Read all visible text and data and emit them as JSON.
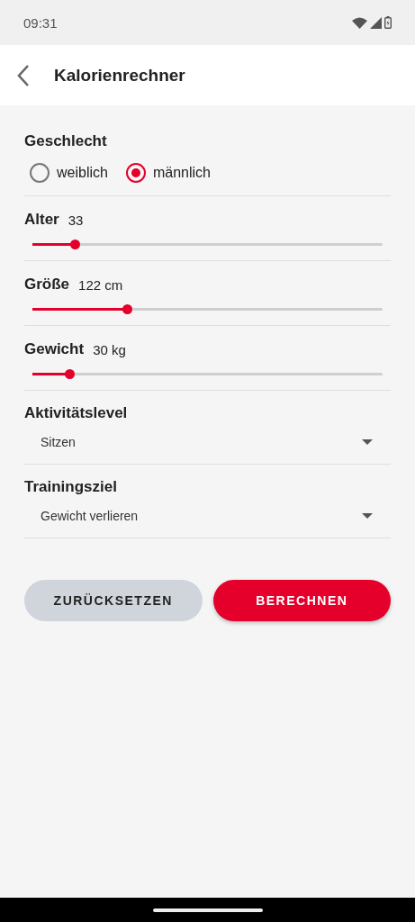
{
  "status_bar": {
    "time": "09:31"
  },
  "header": {
    "title": "Kalorienrechner"
  },
  "gender": {
    "label": "Geschlecht",
    "options": [
      {
        "label": "weiblich",
        "selected": false
      },
      {
        "label": "männlich",
        "selected": true
      }
    ]
  },
  "sliders": [
    {
      "label": "Alter",
      "reading": "33",
      "level": 0.12
    },
    {
      "label": "Größe",
      "reading": "122 cm",
      "level": 0.27
    },
    {
      "label": "Gewicht",
      "reading": "30 kg",
      "level": 0.105
    }
  ],
  "selects": [
    {
      "label": "Aktivitätslevel",
      "value": "Sitzen"
    },
    {
      "label": "Trainingsziel",
      "value": "Gewicht verlieren"
    }
  ],
  "buttons": [
    {
      "label": "ZURÜCKSETZEN",
      "kind": "secondary"
    },
    {
      "label": "BERECHNEN",
      "kind": "primary"
    }
  ]
}
